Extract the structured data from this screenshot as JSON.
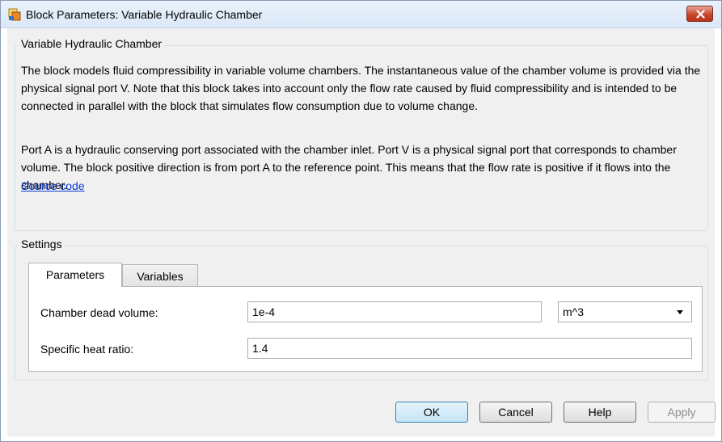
{
  "window": {
    "title": "Block Parameters: Variable Hydraulic Chamber",
    "close_icon": "close-x-icon",
    "app_icon": "simulink-block-icon"
  },
  "description": {
    "group_title": "Variable Hydraulic Chamber",
    "paragraph1": "The block models fluid compressibility in variable volume chambers. The instantaneous value of the chamber volume is provided via the physical signal port V. Note that this block takes into account only the flow rate caused by fluid compressibility and is intended to be connected in parallel with the block that simulates flow consumption due to volume change.",
    "paragraph2": "Port A is a hydraulic conserving port associated with the chamber inlet. Port V is a physical signal port that corresponds to chamber volume. The block positive direction is from port A to the reference point. This means that the flow rate is positive if it flows into the chamber.",
    "link": "Source code"
  },
  "settings": {
    "group_title": "Settings",
    "tabs": [
      {
        "label": "Parameters",
        "active": true
      },
      {
        "label": "Variables",
        "active": false
      }
    ],
    "params": [
      {
        "label": "Chamber dead volume:",
        "value": "1e-4",
        "unit": "m^3"
      },
      {
        "label": "Specific heat ratio:",
        "value": "1.4"
      }
    ]
  },
  "buttons": {
    "ok": "OK",
    "cancel": "Cancel",
    "help": "Help",
    "apply": "Apply"
  }
}
